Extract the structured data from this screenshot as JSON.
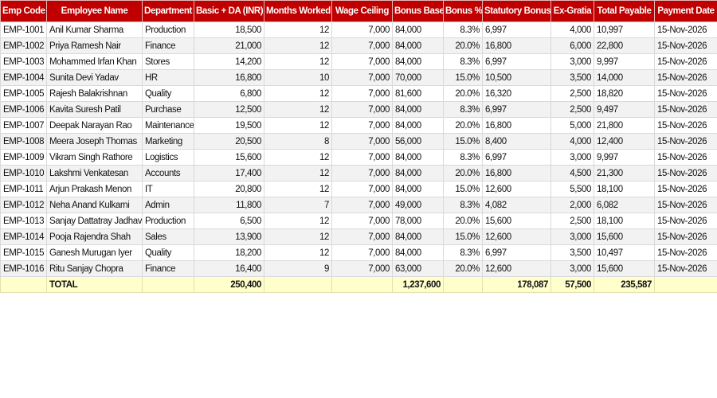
{
  "headers": [
    "Emp Code",
    "Employee Name",
    "Department",
    "Basic + DA (INR)",
    "Months Worked",
    "Wage Ceiling",
    "Bonus Base",
    "Bonus %",
    "Statutory Bonus",
    "Ex-Gratia",
    "Total Payable",
    "Payment Date"
  ],
  "rows": [
    [
      "EMP-1001",
      "Anil Kumar Sharma",
      "Production",
      "18,500",
      "12",
      "7,000",
      "84,000",
      "8.3%",
      "6,997",
      "4,000",
      "10,997",
      "15-Nov-2026"
    ],
    [
      "EMP-1002",
      "Priya Ramesh Nair",
      "Finance",
      "21,000",
      "12",
      "7,000",
      "84,000",
      "20.0%",
      "16,800",
      "6,000",
      "22,800",
      "15-Nov-2026"
    ],
    [
      "EMP-1003",
      "Mohammed Irfan Khan",
      "Stores",
      "14,200",
      "12",
      "7,000",
      "84,000",
      "8.3%",
      "6,997",
      "3,000",
      "9,997",
      "15-Nov-2026"
    ],
    [
      "EMP-1004",
      "Sunita Devi Yadav",
      "HR",
      "16,800",
      "10",
      "7,000",
      "70,000",
      "15.0%",
      "10,500",
      "3,500",
      "14,000",
      "15-Nov-2026"
    ],
    [
      "EMP-1005",
      "Rajesh Balakrishnan",
      "Quality",
      "6,800",
      "12",
      "7,000",
      "81,600",
      "20.0%",
      "16,320",
      "2,500",
      "18,820",
      "15-Nov-2026"
    ],
    [
      "EMP-1006",
      "Kavita Suresh Patil",
      "Purchase",
      "12,500",
      "12",
      "7,000",
      "84,000",
      "8.3%",
      "6,997",
      "2,500",
      "9,497",
      "15-Nov-2026"
    ],
    [
      "EMP-1007",
      "Deepak Narayan Rao",
      "Maintenance",
      "19,500",
      "12",
      "7,000",
      "84,000",
      "20.0%",
      "16,800",
      "5,000",
      "21,800",
      "15-Nov-2026"
    ],
    [
      "EMP-1008",
      "Meera Joseph Thomas",
      "Marketing",
      "20,500",
      "8",
      "7,000",
      "56,000",
      "15.0%",
      "8,400",
      "4,000",
      "12,400",
      "15-Nov-2026"
    ],
    [
      "EMP-1009",
      "Vikram Singh Rathore",
      "Logistics",
      "15,600",
      "12",
      "7,000",
      "84,000",
      "8.3%",
      "6,997",
      "3,000",
      "9,997",
      "15-Nov-2026"
    ],
    [
      "EMP-1010",
      "Lakshmi Venkatesan",
      "Accounts",
      "17,400",
      "12",
      "7,000",
      "84,000",
      "20.0%",
      "16,800",
      "4,500",
      "21,300",
      "15-Nov-2026"
    ],
    [
      "EMP-1011",
      "Arjun Prakash Menon",
      "IT",
      "20,800",
      "12",
      "7,000",
      "84,000",
      "15.0%",
      "12,600",
      "5,500",
      "18,100",
      "15-Nov-2026"
    ],
    [
      "EMP-1012",
      "Neha Anand Kulkarni",
      "Admin",
      "11,800",
      "7",
      "7,000",
      "49,000",
      "8.3%",
      "4,082",
      "2,000",
      "6,082",
      "15-Nov-2026"
    ],
    [
      "EMP-1013",
      "Sanjay Dattatray Jadhav",
      "Production",
      "6,500",
      "12",
      "7,000",
      "78,000",
      "20.0%",
      "15,600",
      "2,500",
      "18,100",
      "15-Nov-2026"
    ],
    [
      "EMP-1014",
      "Pooja Rajendra Shah",
      "Sales",
      "13,900",
      "12",
      "7,000",
      "84,000",
      "15.0%",
      "12,600",
      "3,000",
      "15,600",
      "15-Nov-2026"
    ],
    [
      "EMP-1015",
      "Ganesh Murugan Iyer",
      "Quality",
      "18,200",
      "12",
      "7,000",
      "84,000",
      "8.3%",
      "6,997",
      "3,500",
      "10,497",
      "15-Nov-2026"
    ],
    [
      "EMP-1016",
      "Ritu Sanjay Chopra",
      "Finance",
      "16,400",
      "9",
      "7,000",
      "63,000",
      "20.0%",
      "12,600",
      "3,000",
      "15,600",
      "15-Nov-2026"
    ]
  ],
  "total": [
    "",
    "TOTAL",
    "",
    "250,400",
    "",
    "",
    "1,237,600",
    "",
    "178,087",
    "57,500",
    "235,587",
    ""
  ],
  "colors": {
    "header_bg": "#c00000",
    "header_text": "#ffffff",
    "stripe": "#f2f2f2",
    "total_bg": "#ffffcc"
  }
}
